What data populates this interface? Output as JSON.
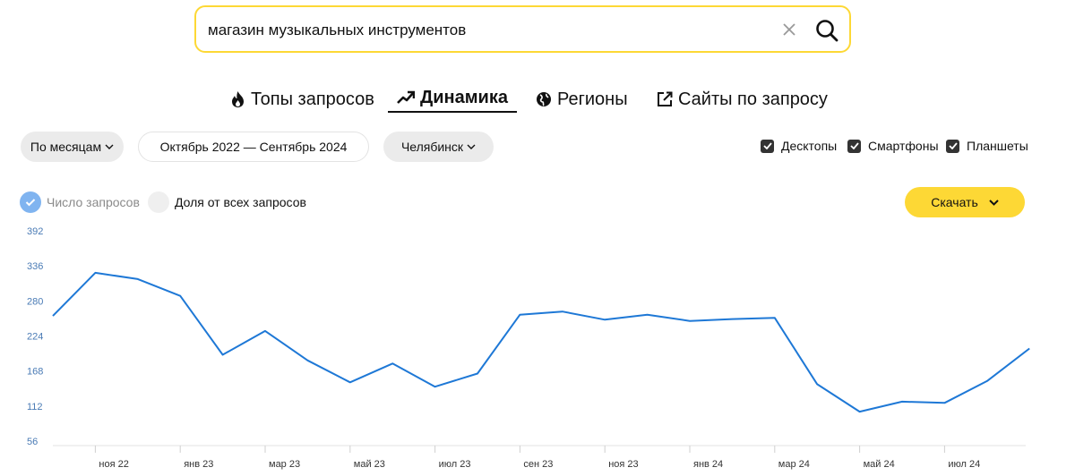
{
  "search": {
    "query": "магазин музыкальных инструментов"
  },
  "tabs": [
    {
      "label": "Топы запросов",
      "icon": "fire-icon"
    },
    {
      "label": "Динамика",
      "icon": "trending-up-icon",
      "active": true
    },
    {
      "label": "Регионы",
      "icon": "globe-icon"
    },
    {
      "label": "Сайты по запросу",
      "icon": "external-link-icon"
    }
  ],
  "filters": {
    "period_type": "По месяцам",
    "date_range": "Октябрь 2022 — Сентябрь 2024",
    "region": "Челябинск"
  },
  "devices": [
    {
      "label": "Десктопы",
      "checked": true
    },
    {
      "label": "Смартфоны",
      "checked": true
    },
    {
      "label": "Планшеты",
      "checked": true
    }
  ],
  "metric": {
    "count_label": "Число запросов",
    "share_label": "Доля от всех запросов",
    "selected": "count"
  },
  "download_label": "Скачать",
  "colors": {
    "accent": "#fdd835",
    "line": "#1e78d6",
    "axis_label": "#4a7bb5"
  },
  "chart_data": {
    "type": "line",
    "y_ticks": [
      "392",
      "336",
      "280",
      "224",
      "168",
      "112",
      "56"
    ],
    "ylim": [
      56,
      392
    ],
    "x_labels": [
      "ноя 22",
      "янв 23",
      "мар 23",
      "май 23",
      "июл 23",
      "сен 23",
      "ноя 23",
      "янв 24",
      "мар 24",
      "май 24",
      "июл 24"
    ],
    "x": [
      "окт 22",
      "ноя 22",
      "дек 22",
      "янв 23",
      "фев 23",
      "мар 23",
      "апр 23",
      "май 23",
      "июн 23",
      "июл 23",
      "авг 23",
      "сен 23",
      "окт 23",
      "ноя 23",
      "дек 23",
      "янв 24",
      "фев 24",
      "мар 24",
      "апр 24",
      "май 24",
      "июн 24",
      "июл 24",
      "авг 24",
      "сен 24"
    ],
    "values": [
      256,
      325,
      315,
      288,
      194,
      232,
      185,
      150,
      180,
      143,
      164,
      258,
      263,
      250,
      258,
      248,
      251,
      253,
      147,
      103,
      119,
      117,
      152,
      204
    ],
    "grid": false
  }
}
